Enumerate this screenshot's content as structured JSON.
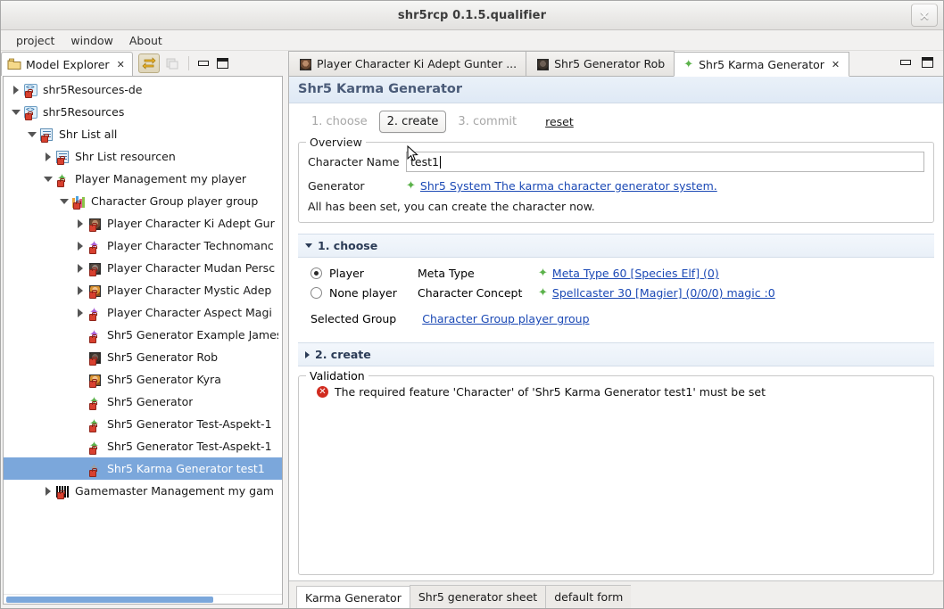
{
  "window": {
    "title": "shr5rcp 0.1.5.qualifier",
    "close_label": "×"
  },
  "menubar": {
    "items": [
      {
        "label": "project"
      },
      {
        "label": "window"
      },
      {
        "label": "About"
      }
    ]
  },
  "model_explorer": {
    "tab_label": "Model Explorer",
    "close_icon": "✕",
    "toolbar": [
      {
        "name": "link-with-editor-icon",
        "state": "pressed"
      },
      {
        "name": "collapse-all-icon",
        "state": "disabled"
      },
      {
        "name": "minimize-icon",
        "state": "normal"
      },
      {
        "name": "maximize-icon",
        "state": "normal"
      }
    ],
    "tree": [
      {
        "label": "shr5Resources-de",
        "indent": 0,
        "twisty": "collapsed",
        "icon": "resource-icon",
        "selected": false
      },
      {
        "label": "shr5Resources",
        "indent": 0,
        "twisty": "expanded",
        "icon": "resource-icon",
        "selected": false
      },
      {
        "label": "Shr List all",
        "indent": 1,
        "twisty": "expanded",
        "icon": "list-icon",
        "selected": false
      },
      {
        "label": "Shr List resourcen",
        "indent": 2,
        "twisty": "collapsed",
        "icon": "list-icon",
        "selected": false
      },
      {
        "label": "Player Management my player",
        "indent": 2,
        "twisty": "expanded",
        "icon": "star-green-icon",
        "selected": false
      },
      {
        "label": "Character Group player group",
        "indent": 3,
        "twisty": "expanded",
        "icon": "group-icon",
        "selected": false
      },
      {
        "label": "Player Character Ki Adept Gur",
        "indent": 4,
        "twisty": "collapsed",
        "icon": "face1-icon",
        "selected": false
      },
      {
        "label": "Player Character Technomanc",
        "indent": 4,
        "twisty": "collapsed",
        "icon": "star-violet-icon",
        "selected": false
      },
      {
        "label": "Player Character Mudan Persc",
        "indent": 4,
        "twisty": "collapsed",
        "icon": "face2-icon",
        "selected": false
      },
      {
        "label": "Player Character Mystic Adep",
        "indent": 4,
        "twisty": "collapsed",
        "icon": "face3-icon",
        "selected": false
      },
      {
        "label": "Player Character Aspect Magi",
        "indent": 4,
        "twisty": "collapsed",
        "icon": "star-violet-icon",
        "selected": false
      },
      {
        "label": "Shr5 Generator Example James",
        "indent": 4,
        "twisty": "none",
        "icon": "star-violet-icon",
        "selected": false
      },
      {
        "label": "Shr5 Generator Rob",
        "indent": 4,
        "twisty": "none",
        "icon": "face4-icon",
        "selected": false
      },
      {
        "label": "Shr5 Generator Kyra",
        "indent": 4,
        "twisty": "none",
        "icon": "face3-icon",
        "selected": false
      },
      {
        "label": "Shr5 Generator",
        "indent": 4,
        "twisty": "none",
        "icon": "star-green-icon",
        "selected": false
      },
      {
        "label": "Shr5 Generator Test-Aspekt-1",
        "indent": 4,
        "twisty": "none",
        "icon": "star-green-icon",
        "selected": false
      },
      {
        "label": "Shr5 Generator Test-Aspekt-1",
        "indent": 4,
        "twisty": "none",
        "icon": "star-green-icon",
        "selected": false
      },
      {
        "label": "Shr5 Karma Generator test1",
        "indent": 4,
        "twisty": "none",
        "icon": "star-gray-icon",
        "selected": true
      },
      {
        "label": "Gamemaster Management my gam",
        "indent": 2,
        "twisty": "collapsed",
        "icon": "gamemaster-icon",
        "selected": false
      }
    ]
  },
  "editor_tabs": {
    "tabs": [
      {
        "label": "Player Character Ki Adept Gunter ...",
        "icon": "face1-icon",
        "active": false,
        "closable": false
      },
      {
        "label": "Shr5 Generator Rob",
        "icon": "face4-icon",
        "active": false,
        "closable": false
      },
      {
        "label": "Shr5 Karma Generator",
        "icon": "star-green-icon",
        "active": true,
        "closable": true,
        "close_icon": "✕"
      }
    ],
    "minimize_icon": "minimize-icon",
    "maximize_icon": "maximize-icon"
  },
  "form": {
    "title": "Shr5 Karma Generator",
    "steps": [
      {
        "label": "1. choose",
        "state": "disabled"
      },
      {
        "label": "2. create",
        "state": "current"
      },
      {
        "label": "3. commit",
        "state": "disabled"
      },
      {
        "label": "reset",
        "state": "enabled"
      }
    ],
    "overview": {
      "legend": "Overview",
      "character_name_label": "Character Name",
      "character_name_value": "test1",
      "character_name_placeholder": "",
      "generator_label": "Generator",
      "generator_link": "Shr5 System The karma character generator system.",
      "status_note": "All has been set, you can create the character now."
    },
    "section_choose": {
      "label": "1. choose",
      "expanded": true,
      "player_radio_label": "Player",
      "player_radio_selected": true,
      "none_player_radio_label": "None player",
      "none_player_radio_selected": false,
      "meta_type_label": "Meta Type",
      "meta_type_link": "Meta Type 60 [Species Elf] (0)",
      "character_concept_label": "Character Concept",
      "character_concept_link": "Spellcaster 30 [Magier] (0/0/0) magic :0",
      "selected_group_label": "Selected Group",
      "selected_group_link": "Character Group player group"
    },
    "section_create": {
      "label": "2. create",
      "expanded": false
    },
    "validation": {
      "legend": "Validation",
      "messages": [
        {
          "severity": "error",
          "text": "The required feature 'Character' of 'Shr5 Karma Generator test1' must be set"
        }
      ]
    },
    "bottom_tabs": [
      {
        "label": "Karma Generator",
        "active": true
      },
      {
        "label": "Shr5 generator sheet",
        "active": false
      },
      {
        "label": "default form",
        "active": false
      }
    ]
  },
  "colors": {
    "selection": "#7ba7db",
    "link": "#1b49b5",
    "title_text": "#4a5b78",
    "error": "#d12b1f",
    "star_green": "#5bb24a"
  }
}
